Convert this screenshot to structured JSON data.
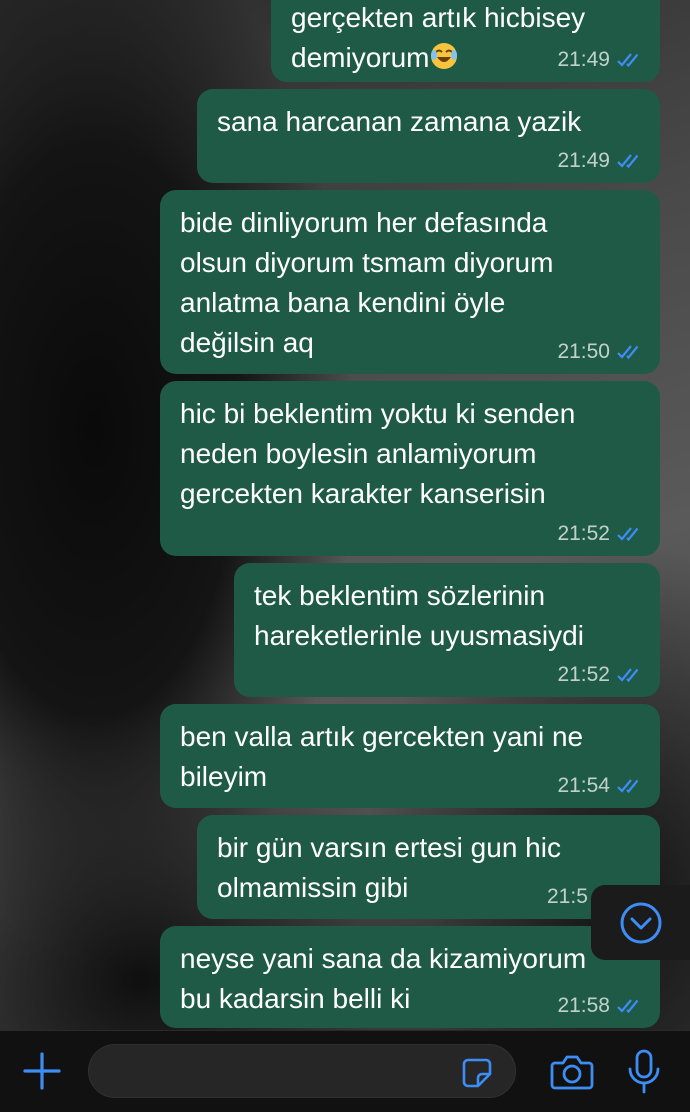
{
  "colors": {
    "bubble": "#1f5a47",
    "accent": "#3c8df5",
    "composer_bg": "#111111"
  },
  "messages": [
    {
      "text": "gerçekten artık hicbisey\ndemiyorum",
      "emoji": "laughing-tears-emoji",
      "time": "21:49",
      "status": "read"
    },
    {
      "text": "sana harcanan zamana yazik",
      "time": "21:49",
      "status": "read"
    },
    {
      "text": "bide dinliyorum her defasında\nolsun diyorum tsmam diyorum\nanlatma bana kendini öyle\ndeğilsin aq",
      "time": "21:50",
      "status": "read"
    },
    {
      "text": "hic bi beklentim yoktu ki senden\nneden boylesin anlamiyorum\ngercekten karakter kanserisin",
      "time": "21:52",
      "status": "read"
    },
    {
      "text": "tek beklentim sözlerinin\nhareketlerinle uyusmasiydi",
      "time": "21:52",
      "status": "read"
    },
    {
      "text": "ben valla artık gercekten yani ne\nbileyim",
      "time": "21:54",
      "status": "read"
    },
    {
      "text": "bir gün varsın ertesi gun hic\nolmamissin gibi",
      "time": "21:5",
      "status": "read"
    },
    {
      "text": "neyse yani sana da kizamiyorum\nbu kadarsin belli ki",
      "time": "21:58",
      "status": "read"
    }
  ],
  "composer": {
    "placeholder": "",
    "icons": [
      "plus-icon",
      "sticker-icon",
      "camera-icon",
      "microphone-icon"
    ]
  },
  "scroll_button_icon": "chevron-down-icon"
}
